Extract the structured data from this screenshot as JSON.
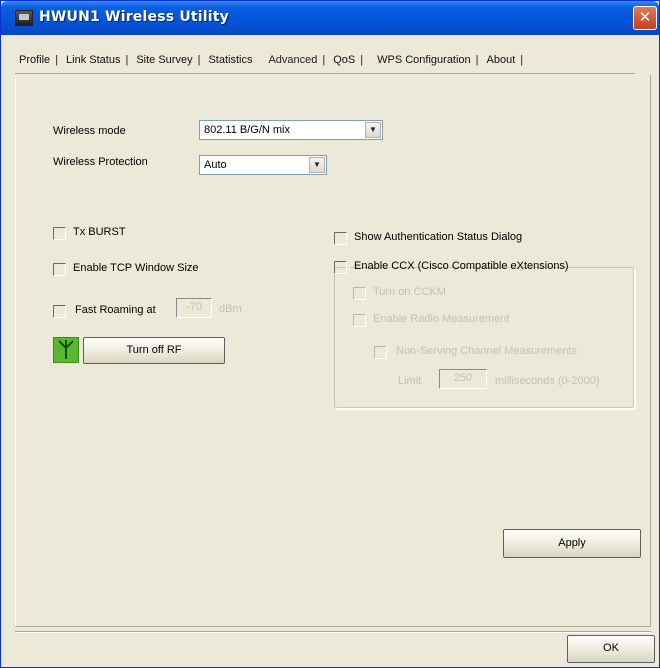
{
  "window": {
    "title": "HWUN1 Wireless Utility",
    "close_label": "✕"
  },
  "tabs": [
    {
      "label": "Profile"
    },
    {
      "label": "Link Status"
    },
    {
      "label": "Site Survey"
    },
    {
      "label": "Statistics"
    },
    {
      "label": "Advanced",
      "active": true
    },
    {
      "label": "QoS"
    },
    {
      "label": "WPS Configuration"
    },
    {
      "label": "About"
    }
  ],
  "advanced": {
    "wireless_mode": {
      "label": "Wireless mode",
      "value": "802.11 B/G/N mix"
    },
    "wireless_protection": {
      "label": "Wireless Protection",
      "value": "Auto"
    },
    "tx_burst": {
      "label": "Tx BURST",
      "checked": false
    },
    "tcp_window": {
      "label": "Enable TCP Window Size",
      "checked": false
    },
    "fast_roaming": {
      "label": "Fast Roaming at",
      "value": "-70",
      "unit": "dBm",
      "checked": false
    },
    "turn_off_rf": {
      "label": "Turn off RF",
      "icon": "antenna-icon"
    },
    "show_auth_dialog": {
      "label": "Show Authentication Status Dialog",
      "checked": false
    },
    "ccx": {
      "label": "Enable CCX (Cisco Compatible eXtensions)",
      "checked": false,
      "turn_on_cckm": {
        "label": "Turn on CCKM",
        "checked": false
      },
      "radio_measurement": {
        "label": "Enable Radio Measurement",
        "checked": false
      },
      "non_serving": {
        "label": "Non-Serving Channel Measurements",
        "checked": false
      },
      "limit": {
        "label": "Limit",
        "value": "250",
        "unit": "milliseconds (0-2000)"
      }
    },
    "apply_label": "Apply"
  },
  "footer": {
    "ok_label": "OK"
  },
  "colors": {
    "titlebar": "#0453d8",
    "window_bg": "#ece9d8",
    "antenna_bg": "#57b92d"
  }
}
